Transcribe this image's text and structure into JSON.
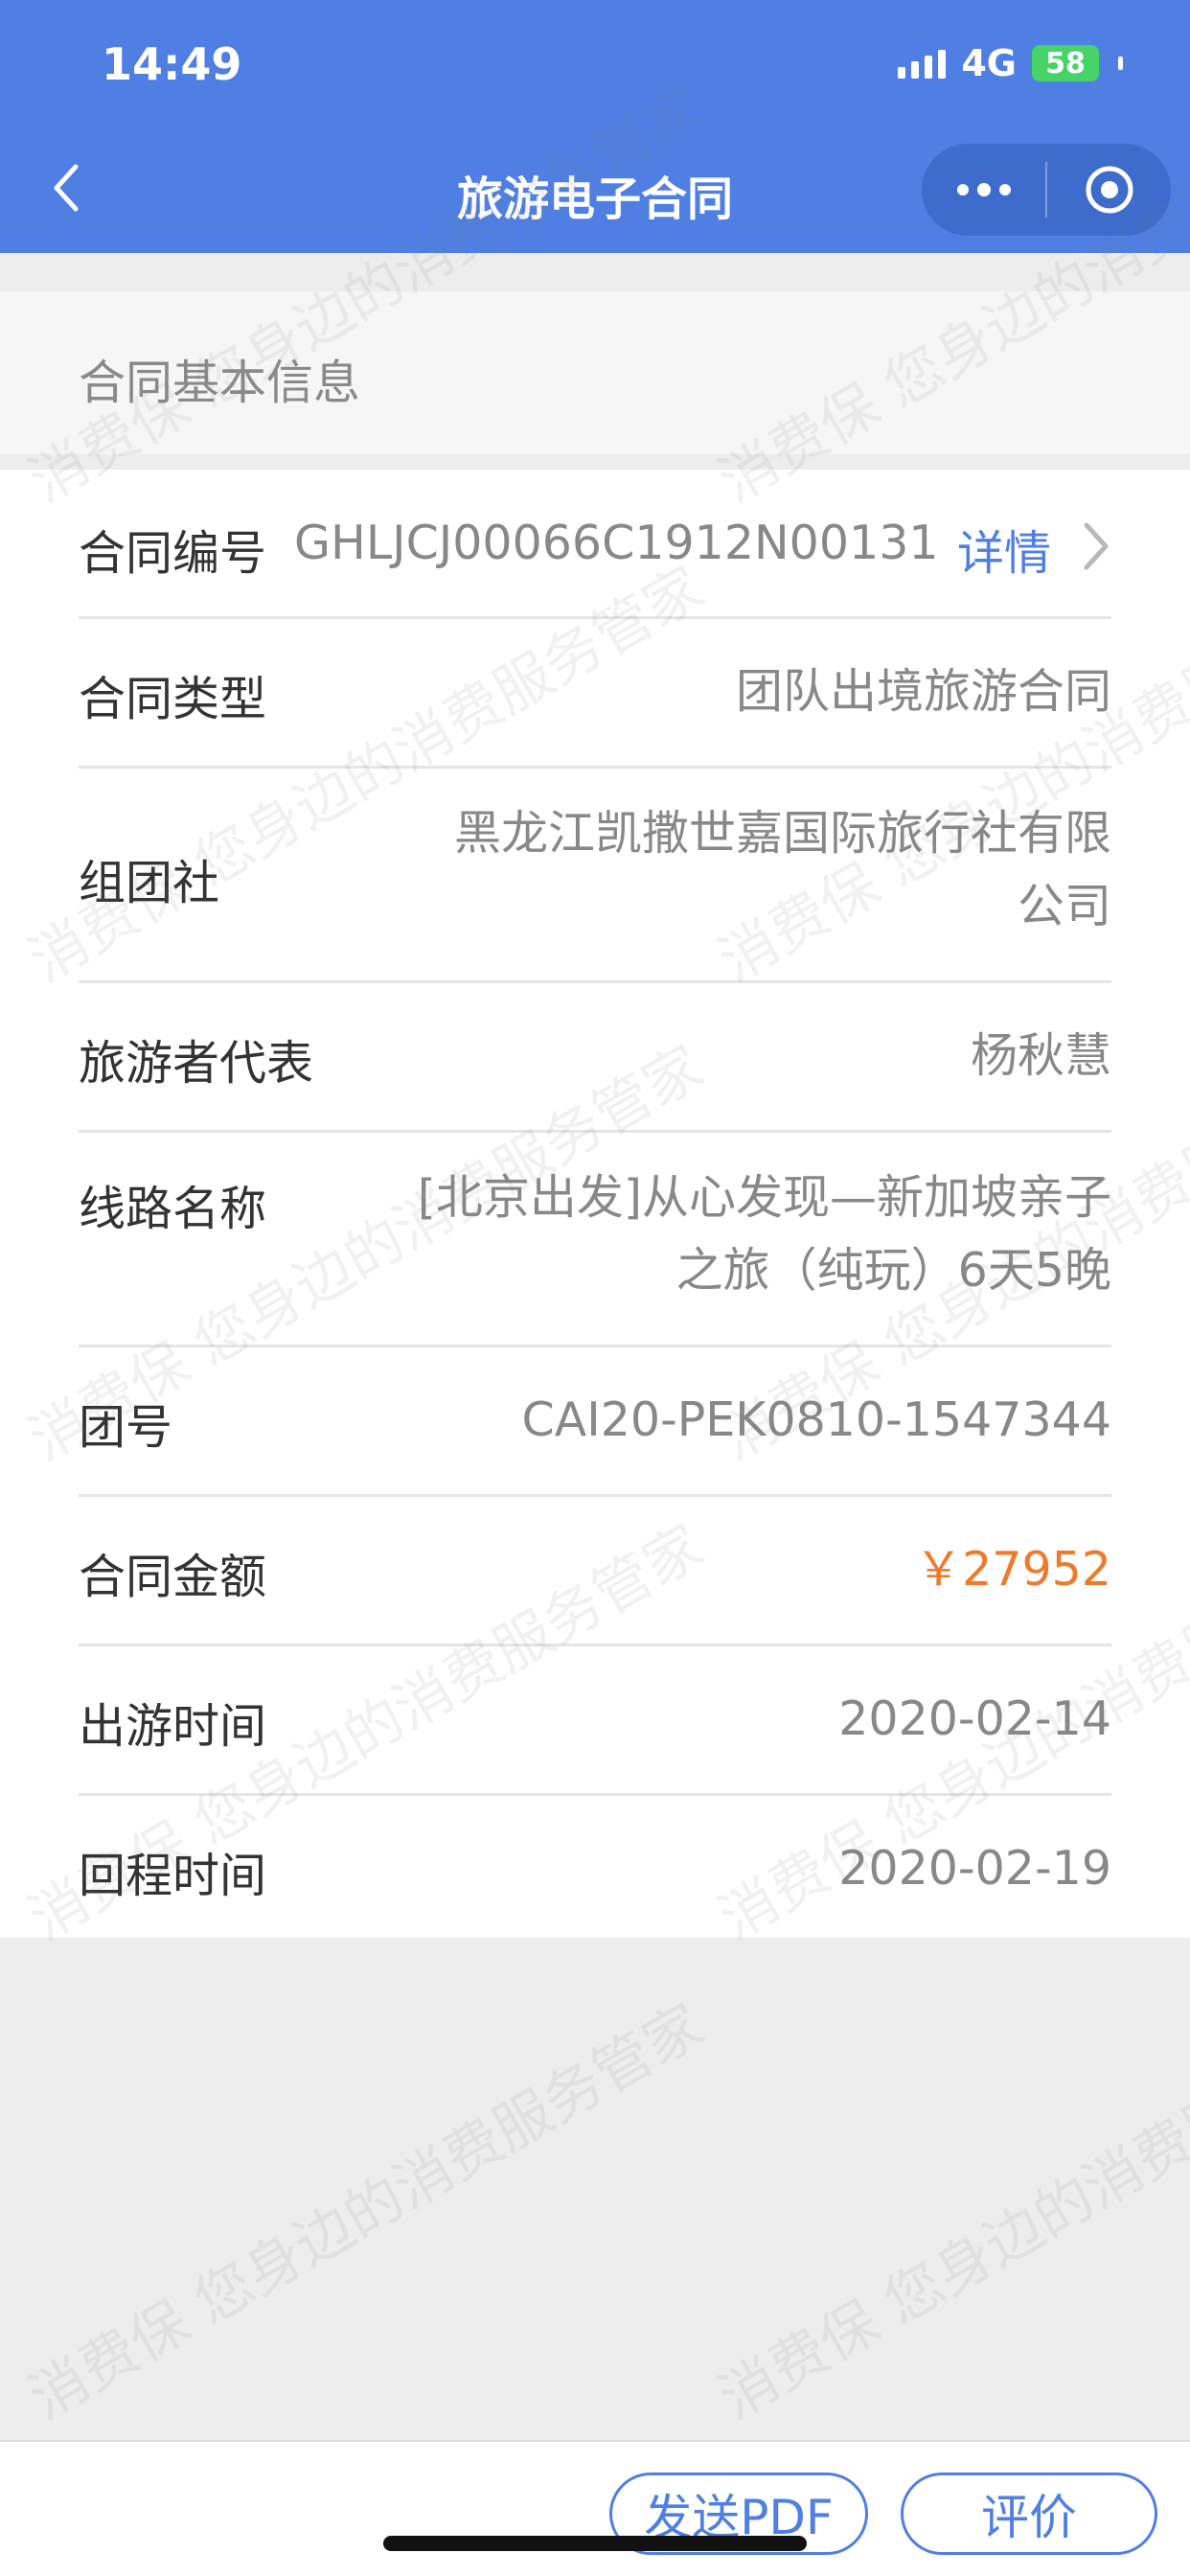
{
  "status_bar": {
    "time": "14:49",
    "network": "4G",
    "battery": "58"
  },
  "header": {
    "title": "旅游电子合同",
    "back_icon": "chevron-left-icon",
    "more_icon": "more-dots-icon",
    "close_icon": "target-circle-icon"
  },
  "section": {
    "title": "合同基本信息"
  },
  "contract": {
    "number_label": "合同编号",
    "number_value": "GHLJCJ00066C1912N00131",
    "detail_link": "详情",
    "type_label": "合同类型",
    "type_value": "团队出境旅游合同",
    "agency_label": "组团社",
    "agency_value_line1": "黑龙江凯撒世嘉国际旅行社有限",
    "agency_value_line2": "公司",
    "traveler_label": "旅游者代表",
    "traveler_value": "杨秋慧",
    "route_label": "线路名称",
    "route_value_line1": "[北京出发]从心发现—新加坡亲子",
    "route_value_line2": "之旅（纯玩）6天5晚",
    "group_label": "团号",
    "group_value": "CAI20-PEK0810-1547344",
    "amount_label": "合同金额",
    "amount_value": "￥27952",
    "depart_label": "出游时间",
    "depart_value": "2020-02-14",
    "return_label": "回程时间",
    "return_value": "2020-02-19"
  },
  "actions": {
    "send_pdf": "发送PDF",
    "rate": "评价"
  },
  "watermark_text": "消费保 您身边的消费服务管家",
  "colors": {
    "header_bg": "#4f7fe3",
    "link": "#4f7fe3",
    "price": "#ef7a2c",
    "battery": "#46d367"
  }
}
